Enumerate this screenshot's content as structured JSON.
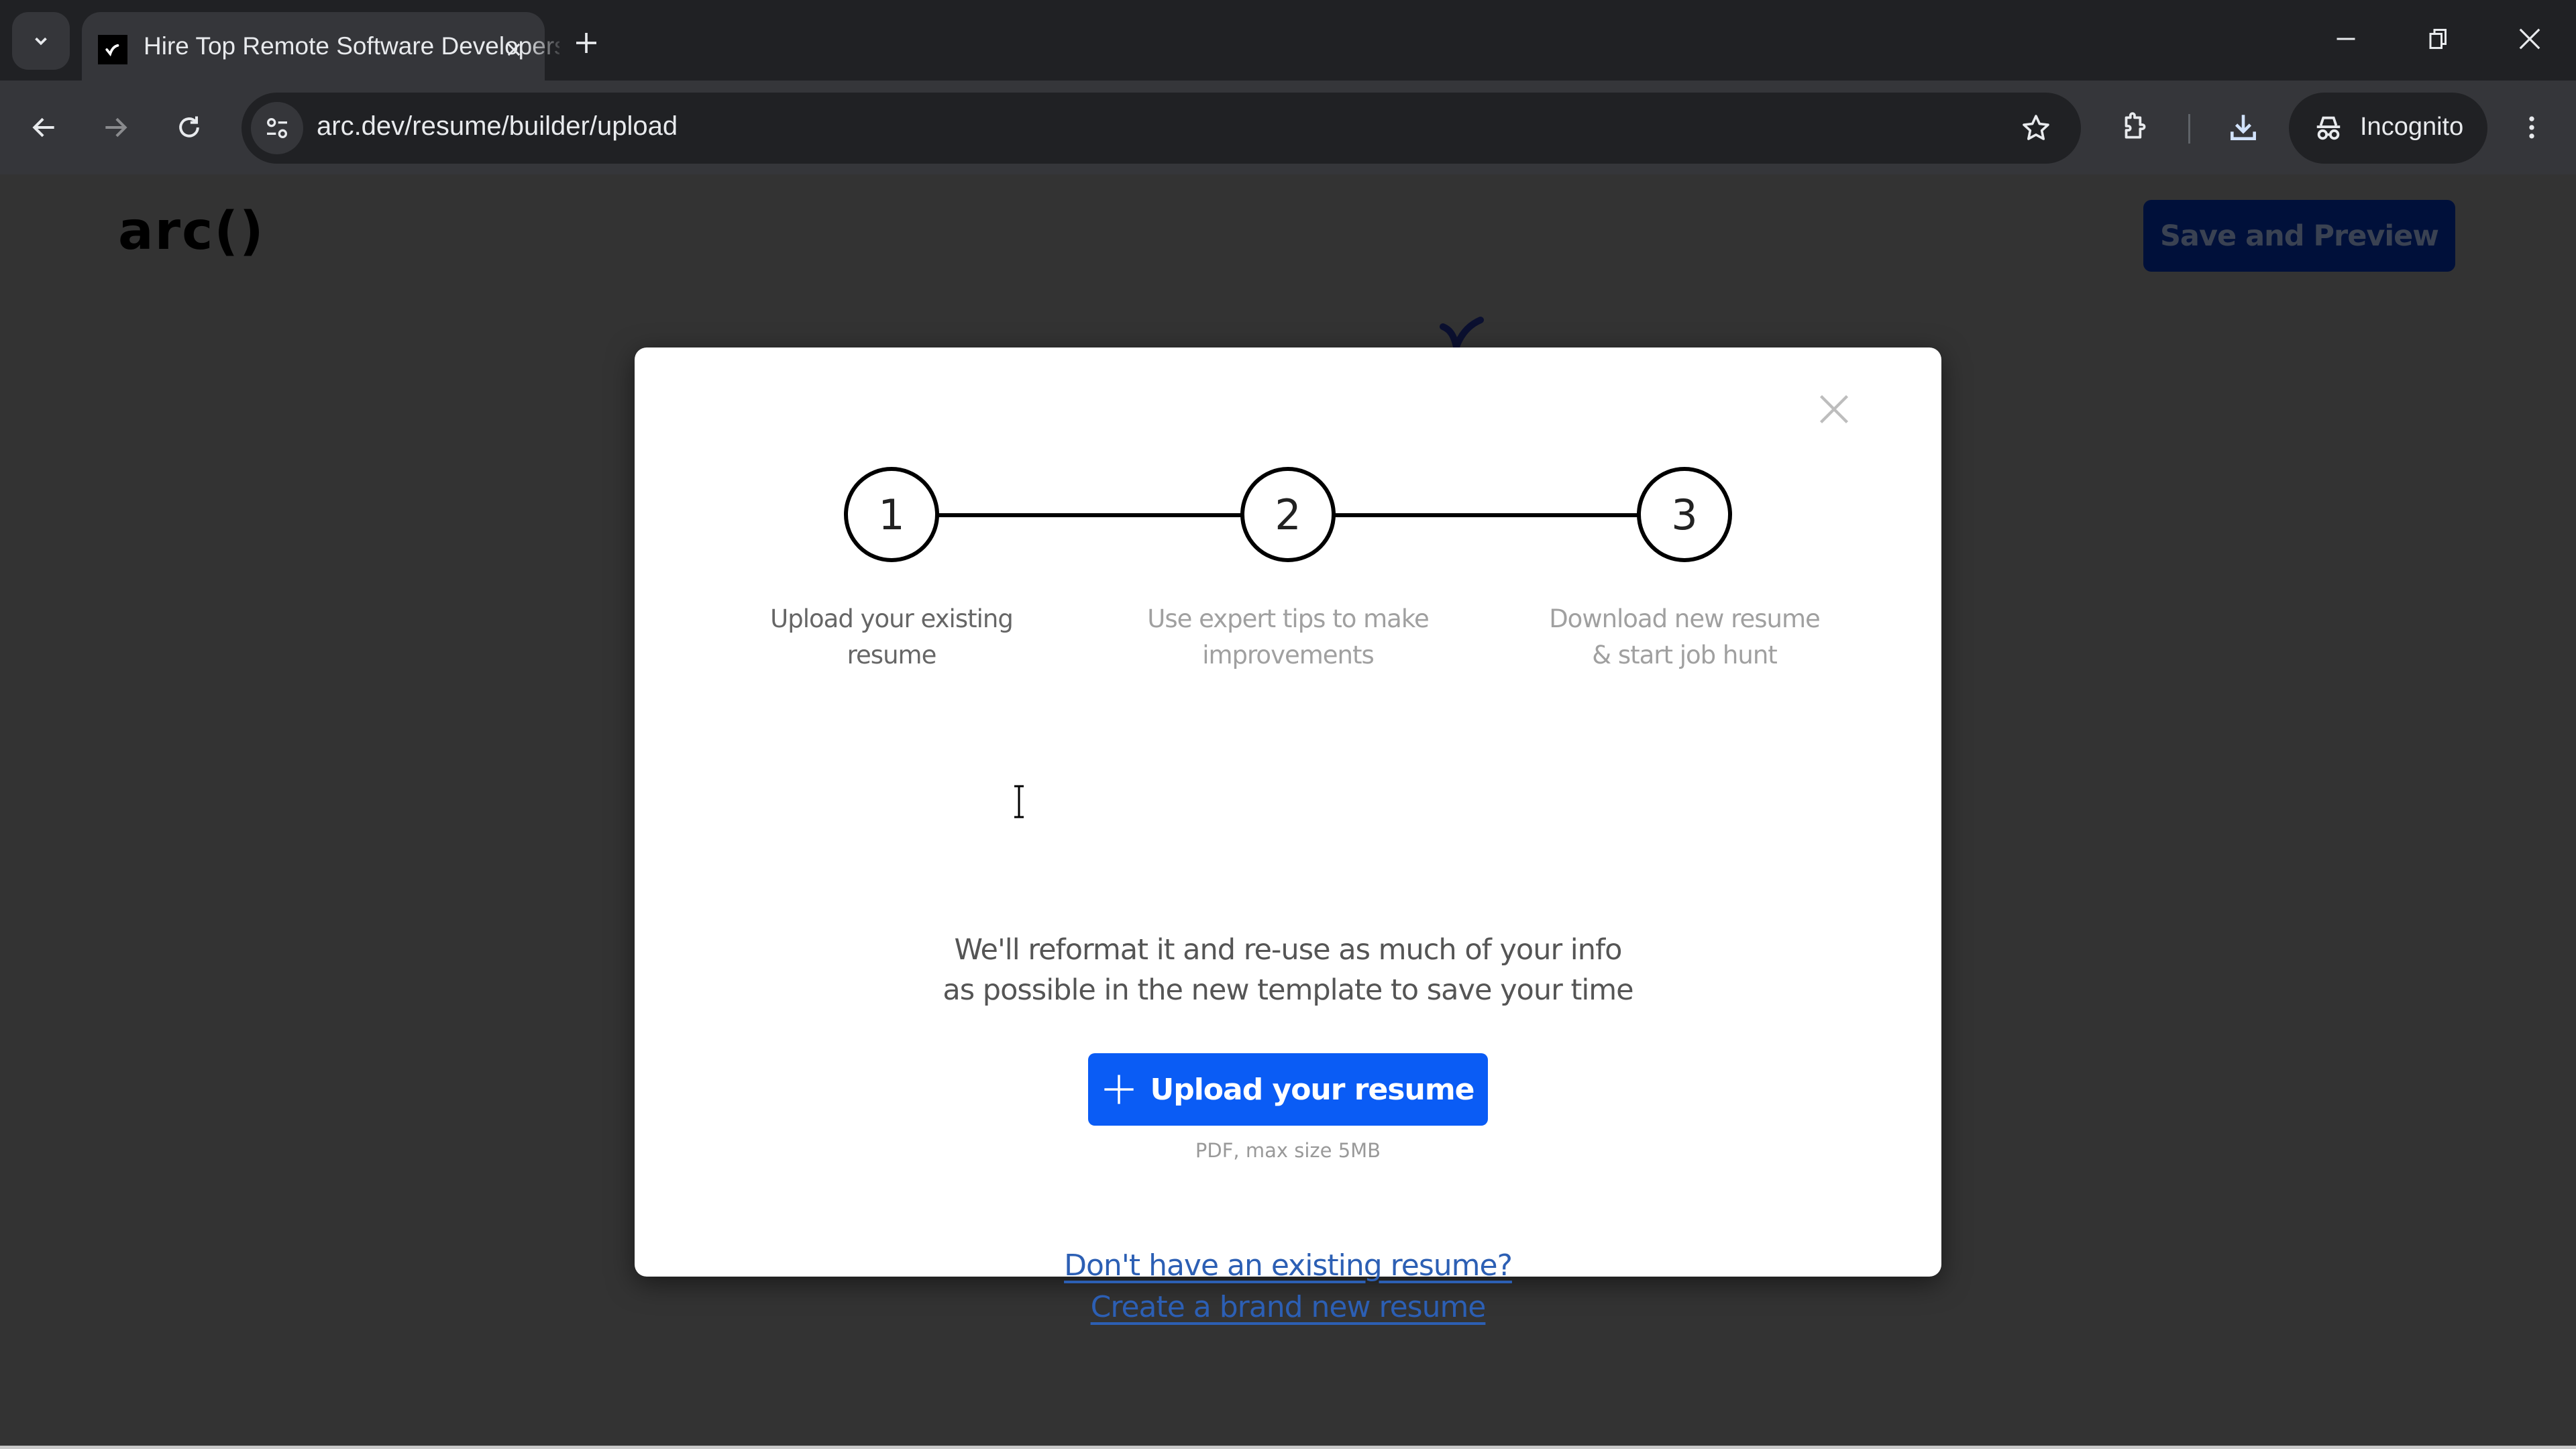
{
  "browser": {
    "tab": {
      "title": "Hire Top Remote Software Developers",
      "favicon": "arc-check-icon"
    },
    "new_tab_label": "+",
    "url": "arc.dev/resume/builder/upload",
    "profile_label": "Incognito",
    "icons": {
      "tab_search": "chevron-down-icon",
      "back": "arrow-left-icon",
      "forward": "arrow-right-icon",
      "reload": "reload-icon",
      "site_info": "tune-icon",
      "bookmark": "star-icon",
      "extensions": "puzzle-icon",
      "downloads": "download-icon",
      "menu": "kebab-icon",
      "minimize": "minimize-icon",
      "restore": "restore-icon",
      "close": "close-icon"
    }
  },
  "page": {
    "logo": "arc()",
    "save_preview_label": "Save and Preview"
  },
  "modal": {
    "steps": [
      {
        "number": "1",
        "label": "Upload your existing resume",
        "active": true
      },
      {
        "number": "2",
        "label": "Use expert tips to make improvements",
        "active": false
      },
      {
        "number": "3",
        "label": "Download new resume & start job hunt",
        "active": false
      }
    ],
    "description_line1": "We'll reformat it and re-use as much of your info",
    "description_line2": "as possible in the new template to save your time",
    "upload_label": "Upload your resume",
    "upload_hint": "PDF, max size 5MB",
    "no_resume_link": "Don't have an existing resume?",
    "create_link": "Create a brand new resume"
  },
  "colors": {
    "accent": "#0a5cf5",
    "link": "#2c5fb4",
    "overlay": "#333333",
    "save_button_dimmed": "#00103a"
  }
}
